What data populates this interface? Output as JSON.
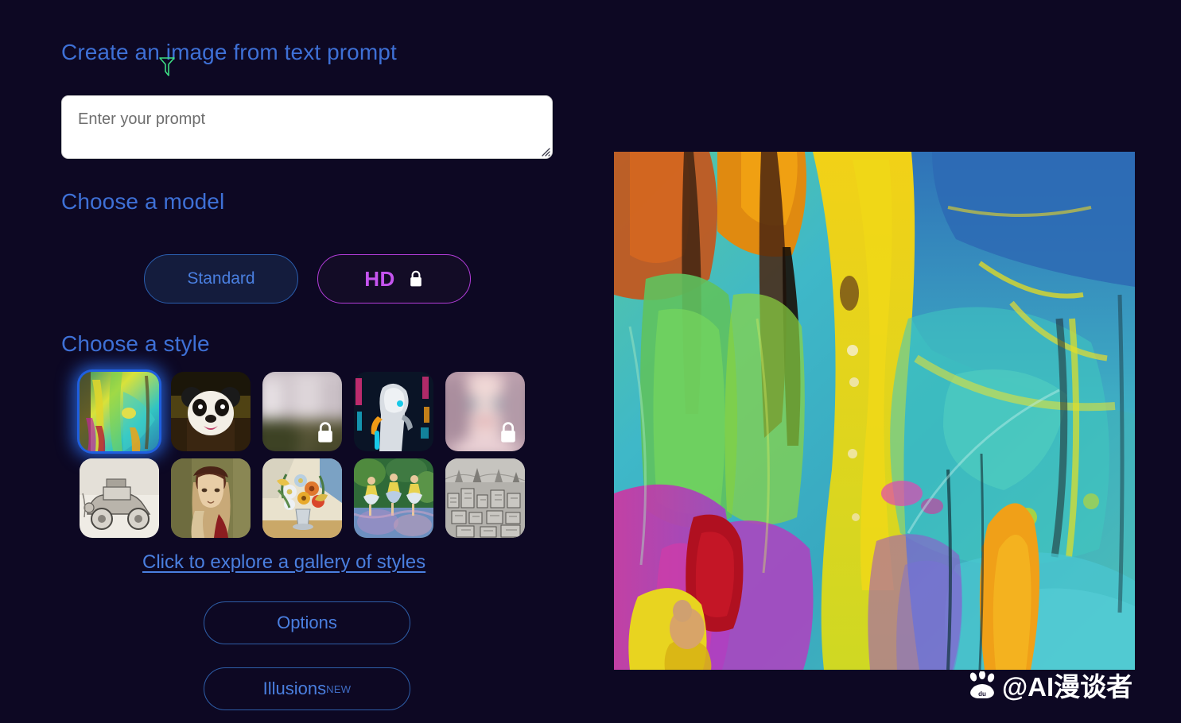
{
  "theme": {
    "background": "#0d0823",
    "accent_blue": "#3e70d6",
    "link_blue": "#4a7fe0",
    "hd_magenta": "#c554ef",
    "hd_border": "#b43ddb",
    "selected_glow": "#1f5fe0"
  },
  "title": "Create an image from text prompt",
  "cursor_icon": "cursor-pointer-icon",
  "prompt": {
    "placeholder": "Enter your prompt",
    "value": "",
    "resize_handle_icon": "resize-grip-icon"
  },
  "model_section": {
    "heading": "Choose a model",
    "options": [
      {
        "label": "Standard",
        "selected": true,
        "locked": false
      },
      {
        "label": "HD",
        "selected": false,
        "locked": true,
        "lock_icon": "lock-icon"
      }
    ]
  },
  "style_section": {
    "heading": "Choose a style",
    "gallery_link": "Click to explore a gallery of styles",
    "thumbnails": [
      {
        "name": "abstract-paint",
        "selected": true,
        "locked": false
      },
      {
        "name": "panda-3d",
        "selected": false,
        "locked": false
      },
      {
        "name": "blurred-locked-landscape",
        "selected": false,
        "locked": true,
        "lock_icon": "lock-icon"
      },
      {
        "name": "cyberpunk-robot",
        "selected": false,
        "locked": false
      },
      {
        "name": "blurred-locked-portrait",
        "selected": false,
        "locked": true,
        "lock_icon": "lock-icon"
      },
      {
        "name": "pencil-sketch-car",
        "selected": false,
        "locked": false
      },
      {
        "name": "renaissance-portrait",
        "selected": false,
        "locked": false
      },
      {
        "name": "still-life-flowers",
        "selected": false,
        "locked": false
      },
      {
        "name": "ballerinas-impressionist",
        "selected": false,
        "locked": false
      },
      {
        "name": "pencil-cityscape",
        "selected": false,
        "locked": false
      }
    ]
  },
  "buttons": {
    "options": "Options",
    "illusions": "Illusions",
    "illusions_badge": "NEW"
  },
  "preview": {
    "alt": "abstract-expressionist-painting"
  },
  "watermark": {
    "logo_icon": "baidu-paw-icon",
    "text": "@AI漫谈者"
  }
}
